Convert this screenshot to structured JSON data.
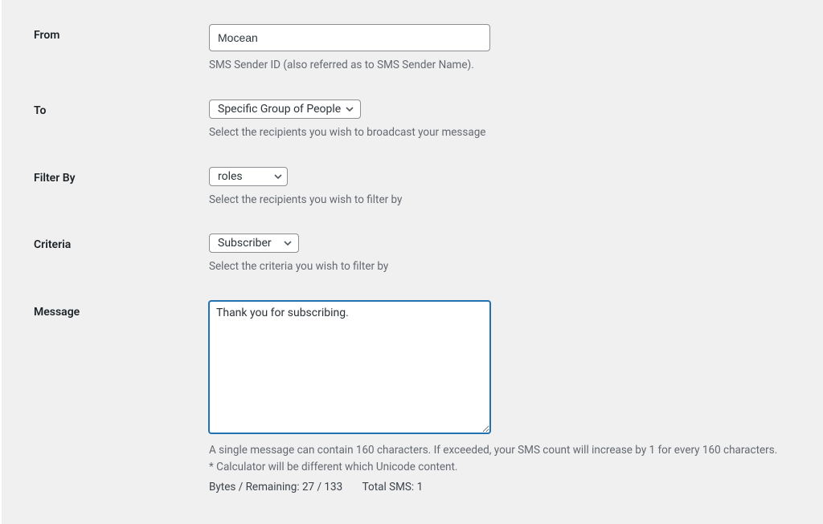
{
  "fields": {
    "from": {
      "label": "From",
      "value": "Mocean",
      "help": "SMS Sender ID (also referred as to SMS Sender Name)."
    },
    "to": {
      "label": "To",
      "value": "Specific Group of People",
      "help": "Select the recipients you wish to broadcast your message"
    },
    "filter_by": {
      "label": "Filter By",
      "value": "roles",
      "help": "Select the recipients you wish to filter by"
    },
    "criteria": {
      "label": "Criteria",
      "value": "Subscriber",
      "help": "Select the criteria you wish to filter by"
    },
    "message": {
      "label": "Message",
      "value": "Thank you for subscribing.",
      "help_line1": "A single message can contain 160 characters. If exceeded, your SMS count will increase by 1 for every 160 characters.",
      "help_line2": "* Calculator will be different which Unicode content.",
      "counter_label": "Bytes / Remaining:",
      "counter_value": "27 / 133",
      "total_label": "Total SMS:",
      "total_value": "1"
    }
  }
}
